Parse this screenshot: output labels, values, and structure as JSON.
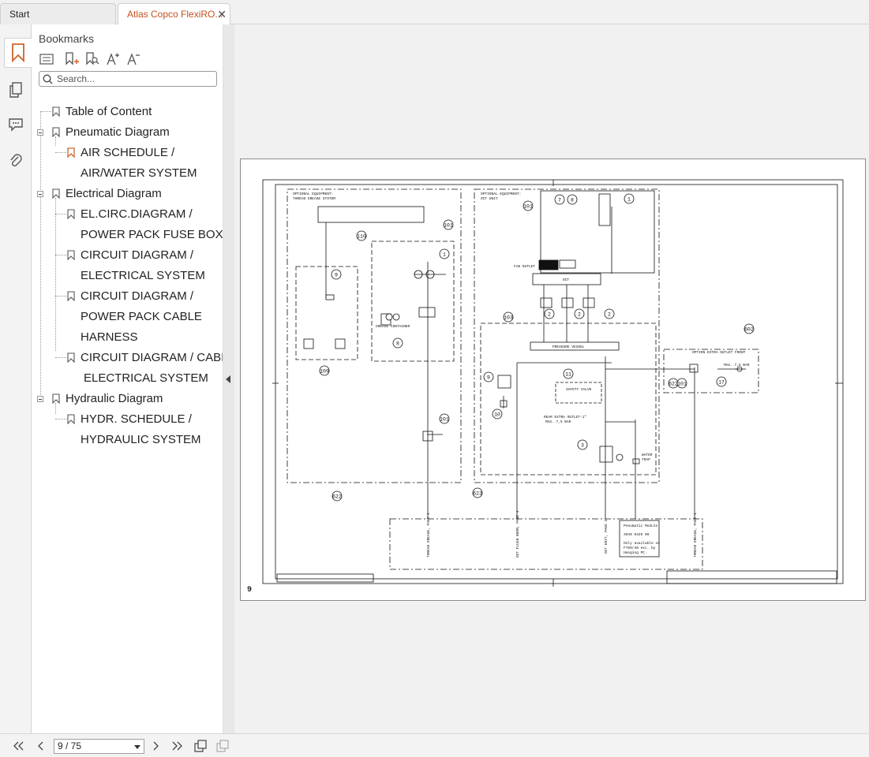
{
  "tabs": [
    {
      "label": "Start"
    },
    {
      "label": "Atlas Copco FlexiRO..."
    }
  ],
  "tab_close": "✕",
  "bookmarks_panel": {
    "title": "Bookmarks",
    "search_placeholder": "Search...",
    "items": [
      {
        "label": "Table of Content"
      },
      {
        "label": "Pneumatic Diagram"
      },
      {
        "label": "AIR SCHEDULE /",
        "label2": "AIR/WATER SYSTEM"
      },
      {
        "label": "Electrical Diagram"
      },
      {
        "label": "EL.CIRC.DIAGRAM /",
        "label2": "POWER PACK FUSE BOX"
      },
      {
        "label": "CIRCUIT DIAGRAM /",
        "label2": "ELECTRICAL SYSTEM"
      },
      {
        "label": "CIRCUIT DIAGRAM /",
        "label2": "POWER PACK CABLE",
        "label3": "HARNESS"
      },
      {
        "label": "CIRCUIT DIAGRAM / CABIN",
        "label2": "ELECTRICAL SYSTEM"
      },
      {
        "label": "Hydraulic Diagram"
      },
      {
        "label": "HYDR. SCHEDULE /",
        "label2": "HYDRAULIC SYSTEM"
      }
    ]
  },
  "page": {
    "page_number_label": "9",
    "diagram": {
      "labels": [
        "OPTIONAL EQUIPMENT:",
        "THREAD GREASE SYSTEM",
        "OPTIONAL EQUIPMENT:",
        "OCT UNIT",
        "FAN OUTLET",
        "OCT",
        "PRESSURE VESSEL",
        "SAFETY VALVE",
        "GREASE CONTAINER",
        "REAR EXTRA OUTLET-1\"",
        "MAX. 7,5 BAR",
        "OPTION EXTRA OUTLET FRONT",
        "MAX. 7,5 BAR",
        "WATER TRAP",
        "Pneumatic Module",
        "3949 0425 00",
        "Only available on FT50/40 exc. by Hanging PC.",
        "THREAD GREASE, PAGE 4",
        "OCT FLUSH BOOM, PAGE 4",
        "OCT UNIT, PAGE 3",
        "THREAD GREASE, PAGE 4"
      ],
      "callouts": [
        "110",
        "101",
        "1",
        "9",
        "8",
        "109",
        "101",
        "622",
        "103",
        "7",
        "8",
        "1",
        "2",
        "2",
        "2",
        "103",
        "11",
        "9",
        "10",
        "3",
        "602",
        "622",
        "101",
        "11",
        "623"
      ]
    }
  },
  "bottom_bar": {
    "page_indicator": "9 / 75"
  }
}
